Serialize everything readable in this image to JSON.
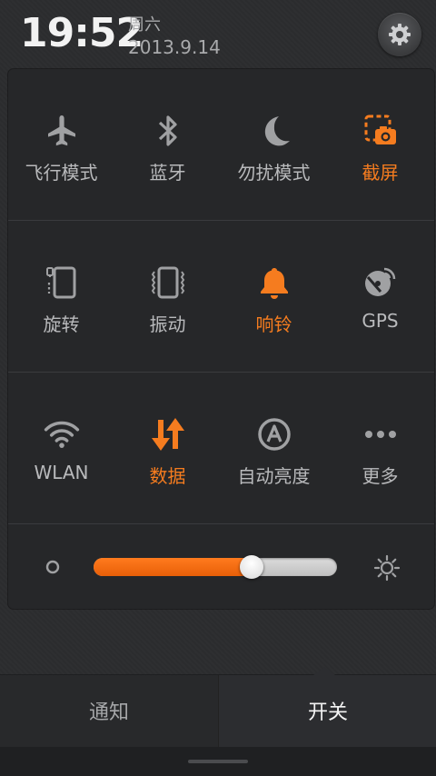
{
  "header": {
    "time": "19:52",
    "weekday": "周六",
    "date": "2013.9.14",
    "settings_icon": "gear-icon"
  },
  "toggles": {
    "row1": [
      {
        "label": "飞行模式",
        "icon": "airplane-icon",
        "active": false
      },
      {
        "label": "蓝牙",
        "icon": "bluetooth-icon",
        "active": false
      },
      {
        "label": "勿扰模式",
        "icon": "moon-icon",
        "active": false
      },
      {
        "label": "截屏",
        "icon": "screenshot-icon",
        "active": true
      }
    ],
    "row2": [
      {
        "label": "旋转",
        "icon": "rotate-icon",
        "active": false
      },
      {
        "label": "振动",
        "icon": "vibrate-icon",
        "active": false
      },
      {
        "label": "响铃",
        "icon": "bell-icon",
        "active": true
      },
      {
        "label": "GPS",
        "icon": "gps-icon",
        "active": false
      }
    ],
    "row3": [
      {
        "label": "WLAN",
        "icon": "wifi-icon",
        "active": false
      },
      {
        "label": "数据",
        "icon": "data-arrows-icon",
        "active": true
      },
      {
        "label": "自动亮度",
        "icon": "auto-brightness-icon",
        "active": false
      },
      {
        "label": "更多",
        "icon": "more-dots-icon",
        "active": false
      }
    ]
  },
  "brightness": {
    "level": 0.65
  },
  "tabs": {
    "notifications": "通知",
    "toggles": "开关",
    "selected": "toggles"
  },
  "colors": {
    "accent": "#f57c1f",
    "icon_gray": "#a0a1a3",
    "panel": "#262729"
  }
}
